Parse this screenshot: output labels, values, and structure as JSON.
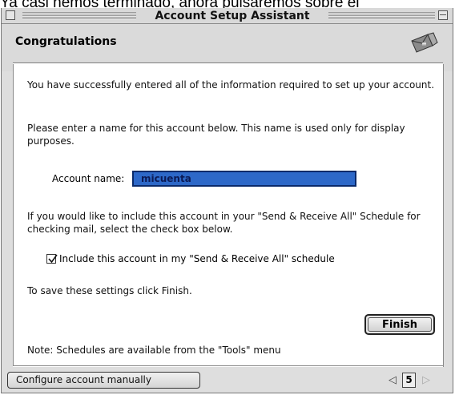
{
  "caption": "Ya casi hemos terminado, ahora pulsaremos sobre el",
  "window": {
    "title": "Account Setup Assistant"
  },
  "header": {
    "title": "Congratulations"
  },
  "content": {
    "intro": "You have successfully entered all of the information required to set up your account.",
    "name_prompt": "Please enter a name for this account below. This name is used only for display purposes.",
    "account_name_label": "Account name:",
    "account_name_value": "micuenta",
    "schedule_prompt": "If you would like to include this account in your \"Send & Receive All\" Schedule for checking mail, select the check box below.",
    "include_checkbox_label": "Include this account in my \"Send & Receive All\" schedule",
    "include_checked": true,
    "save_prompt": "To save these settings click Finish.",
    "finish_label": "Finish",
    "note": "Note: Schedules are available from the \"Tools\" menu"
  },
  "footer": {
    "manual_button_label": "Configure account manually",
    "page_number": "5",
    "prev_icon": "left-arrow-icon",
    "next_icon": "right-arrow-icon"
  },
  "icons": {
    "logo": "mail-assistant-icon",
    "checkmark": "checkmark-icon"
  },
  "colors": {
    "selection": "#2d68c8",
    "window_bg": "#dedede"
  }
}
